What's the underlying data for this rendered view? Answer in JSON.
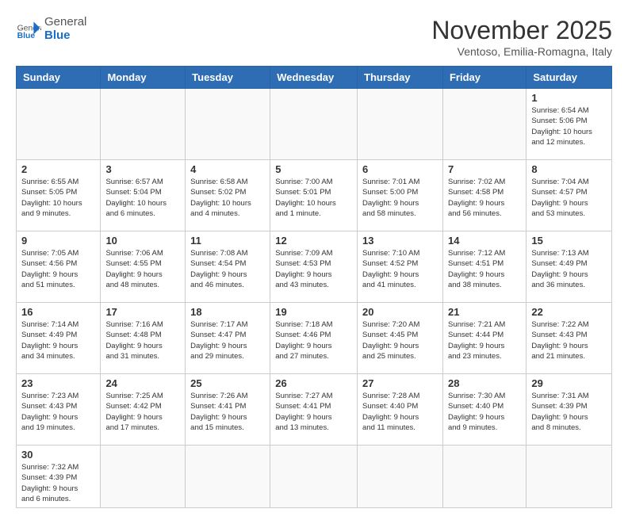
{
  "header": {
    "logo_general": "General",
    "logo_blue": "Blue",
    "month_title": "November 2025",
    "subtitle": "Ventoso, Emilia-Romagna, Italy"
  },
  "weekdays": [
    "Sunday",
    "Monday",
    "Tuesday",
    "Wednesday",
    "Thursday",
    "Friday",
    "Saturday"
  ],
  "weeks": [
    [
      {
        "day": "",
        "info": ""
      },
      {
        "day": "",
        "info": ""
      },
      {
        "day": "",
        "info": ""
      },
      {
        "day": "",
        "info": ""
      },
      {
        "day": "",
        "info": ""
      },
      {
        "day": "",
        "info": ""
      },
      {
        "day": "1",
        "info": "Sunrise: 6:54 AM\nSunset: 5:06 PM\nDaylight: 10 hours\nand 12 minutes."
      }
    ],
    [
      {
        "day": "2",
        "info": "Sunrise: 6:55 AM\nSunset: 5:05 PM\nDaylight: 10 hours\nand 9 minutes."
      },
      {
        "day": "3",
        "info": "Sunrise: 6:57 AM\nSunset: 5:04 PM\nDaylight: 10 hours\nand 6 minutes."
      },
      {
        "day": "4",
        "info": "Sunrise: 6:58 AM\nSunset: 5:02 PM\nDaylight: 10 hours\nand 4 minutes."
      },
      {
        "day": "5",
        "info": "Sunrise: 7:00 AM\nSunset: 5:01 PM\nDaylight: 10 hours\nand 1 minute."
      },
      {
        "day": "6",
        "info": "Sunrise: 7:01 AM\nSunset: 5:00 PM\nDaylight: 9 hours\nand 58 minutes."
      },
      {
        "day": "7",
        "info": "Sunrise: 7:02 AM\nSunset: 4:58 PM\nDaylight: 9 hours\nand 56 minutes."
      },
      {
        "day": "8",
        "info": "Sunrise: 7:04 AM\nSunset: 4:57 PM\nDaylight: 9 hours\nand 53 minutes."
      }
    ],
    [
      {
        "day": "9",
        "info": "Sunrise: 7:05 AM\nSunset: 4:56 PM\nDaylight: 9 hours\nand 51 minutes."
      },
      {
        "day": "10",
        "info": "Sunrise: 7:06 AM\nSunset: 4:55 PM\nDaylight: 9 hours\nand 48 minutes."
      },
      {
        "day": "11",
        "info": "Sunrise: 7:08 AM\nSunset: 4:54 PM\nDaylight: 9 hours\nand 46 minutes."
      },
      {
        "day": "12",
        "info": "Sunrise: 7:09 AM\nSunset: 4:53 PM\nDaylight: 9 hours\nand 43 minutes."
      },
      {
        "day": "13",
        "info": "Sunrise: 7:10 AM\nSunset: 4:52 PM\nDaylight: 9 hours\nand 41 minutes."
      },
      {
        "day": "14",
        "info": "Sunrise: 7:12 AM\nSunset: 4:51 PM\nDaylight: 9 hours\nand 38 minutes."
      },
      {
        "day": "15",
        "info": "Sunrise: 7:13 AM\nSunset: 4:49 PM\nDaylight: 9 hours\nand 36 minutes."
      }
    ],
    [
      {
        "day": "16",
        "info": "Sunrise: 7:14 AM\nSunset: 4:49 PM\nDaylight: 9 hours\nand 34 minutes."
      },
      {
        "day": "17",
        "info": "Sunrise: 7:16 AM\nSunset: 4:48 PM\nDaylight: 9 hours\nand 31 minutes."
      },
      {
        "day": "18",
        "info": "Sunrise: 7:17 AM\nSunset: 4:47 PM\nDaylight: 9 hours\nand 29 minutes."
      },
      {
        "day": "19",
        "info": "Sunrise: 7:18 AM\nSunset: 4:46 PM\nDaylight: 9 hours\nand 27 minutes."
      },
      {
        "day": "20",
        "info": "Sunrise: 7:20 AM\nSunset: 4:45 PM\nDaylight: 9 hours\nand 25 minutes."
      },
      {
        "day": "21",
        "info": "Sunrise: 7:21 AM\nSunset: 4:44 PM\nDaylight: 9 hours\nand 23 minutes."
      },
      {
        "day": "22",
        "info": "Sunrise: 7:22 AM\nSunset: 4:43 PM\nDaylight: 9 hours\nand 21 minutes."
      }
    ],
    [
      {
        "day": "23",
        "info": "Sunrise: 7:23 AM\nSunset: 4:43 PM\nDaylight: 9 hours\nand 19 minutes."
      },
      {
        "day": "24",
        "info": "Sunrise: 7:25 AM\nSunset: 4:42 PM\nDaylight: 9 hours\nand 17 minutes."
      },
      {
        "day": "25",
        "info": "Sunrise: 7:26 AM\nSunset: 4:41 PM\nDaylight: 9 hours\nand 15 minutes."
      },
      {
        "day": "26",
        "info": "Sunrise: 7:27 AM\nSunset: 4:41 PM\nDaylight: 9 hours\nand 13 minutes."
      },
      {
        "day": "27",
        "info": "Sunrise: 7:28 AM\nSunset: 4:40 PM\nDaylight: 9 hours\nand 11 minutes."
      },
      {
        "day": "28",
        "info": "Sunrise: 7:30 AM\nSunset: 4:40 PM\nDaylight: 9 hours\nand 9 minutes."
      },
      {
        "day": "29",
        "info": "Sunrise: 7:31 AM\nSunset: 4:39 PM\nDaylight: 9 hours\nand 8 minutes."
      }
    ],
    [
      {
        "day": "30",
        "info": "Sunrise: 7:32 AM\nSunset: 4:39 PM\nDaylight: 9 hours\nand 6 minutes."
      },
      {
        "day": "",
        "info": ""
      },
      {
        "day": "",
        "info": ""
      },
      {
        "day": "",
        "info": ""
      },
      {
        "day": "",
        "info": ""
      },
      {
        "day": "",
        "info": ""
      },
      {
        "day": "",
        "info": ""
      }
    ]
  ]
}
